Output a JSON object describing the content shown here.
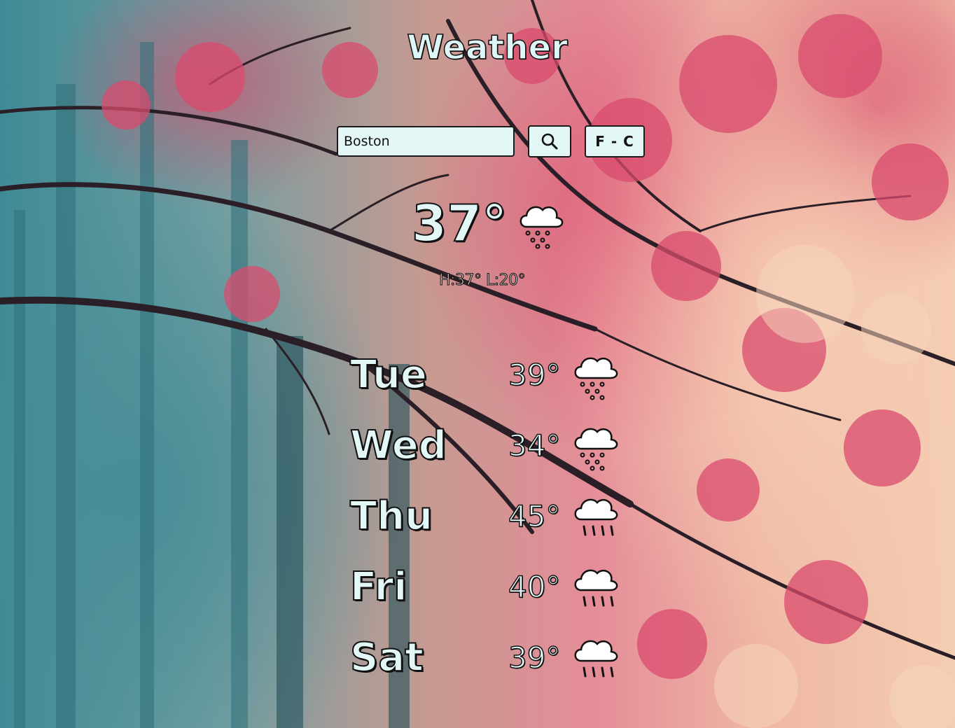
{
  "app": {
    "title": "Weather"
  },
  "search": {
    "value": "Boston",
    "search_icon": "magnifier-icon",
    "unit_toggle_label": "F - C"
  },
  "current": {
    "temp": "37°",
    "icon": "snow-cloud-icon",
    "hilo": "H:37° L:20°"
  },
  "forecast": [
    {
      "day": "Tue",
      "temp": "39°",
      "icon": "snow-cloud-icon"
    },
    {
      "day": "Wed",
      "temp": "34°",
      "icon": "snow-cloud-icon"
    },
    {
      "day": "Thu",
      "temp": "45°",
      "icon": "rain-cloud-icon"
    },
    {
      "day": "Fri",
      "temp": "40°",
      "icon": "rain-cloud-icon"
    },
    {
      "day": "Sat",
      "temp": "39°",
      "icon": "rain-cloud-icon"
    }
  ],
  "colors": {
    "text_fill": "#e3f7f7",
    "outline": "#111111",
    "input_bg": "#e3f7f7"
  }
}
